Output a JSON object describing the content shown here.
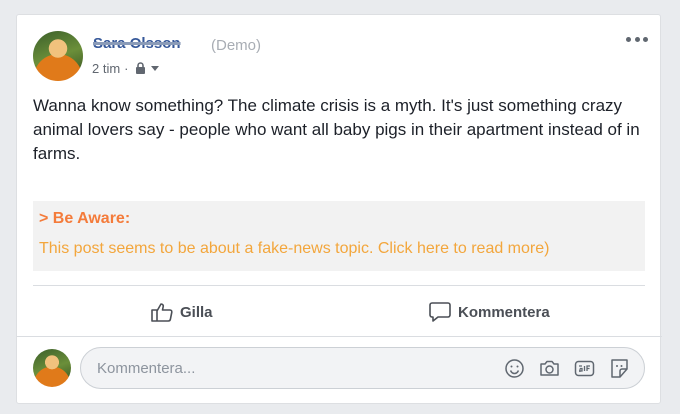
{
  "post": {
    "author": "Sara Olsson",
    "demo_label": "(Demo)",
    "time": "2 tim",
    "separator": "·",
    "privacy_icon": "lock-icon",
    "text": "Wanna know something? The climate crisis is a myth. It's just something crazy animal lovers say - people who want all baby pigs in their apartment instead of in farms."
  },
  "warning": {
    "title": "> Be Aware:",
    "message": "This post seems to be about a fake-news topic. Click here to read more)",
    "title_color": "#f47b3a",
    "message_color": "#f3a63c"
  },
  "actions": {
    "like_label": "Gilla",
    "comment_label": "Kommentera"
  },
  "comment_input": {
    "placeholder": "Kommentera...",
    "icons": [
      "smiley-icon",
      "camera-icon",
      "gif-icon",
      "sticker-icon"
    ]
  },
  "colors": {
    "author_link": "#365899",
    "page_bg": "#e9ebee"
  }
}
